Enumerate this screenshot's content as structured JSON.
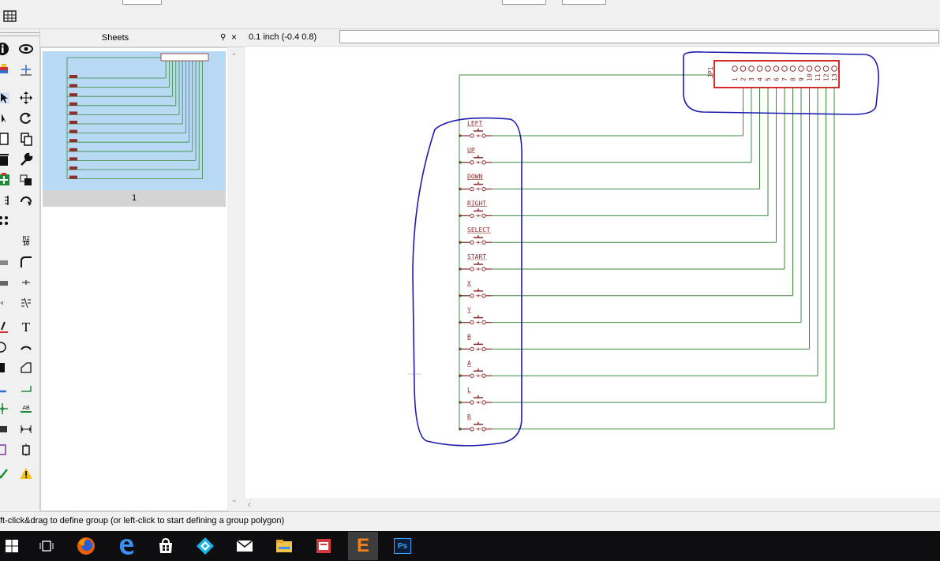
{
  "toolbar": {
    "grid_icon": "grid-icon"
  },
  "left_toolbar": {
    "icons": [
      "info-icon",
      "eye-icon",
      "layer-icon",
      "mark-icon",
      "select-icon",
      "move-icon",
      "copy-pointer-icon",
      "rotate-icon",
      "copy-icon",
      "paste-icon",
      "delete-icon",
      "wrench-icon",
      "add-icon",
      "replace-icon",
      "name-icon",
      "mirror-icon",
      "smash-icon",
      "value-icon",
      "miter-icon",
      "split-icon",
      "junction-icon",
      "label-icon",
      "line-icon",
      "text-icon",
      "circle-icon",
      "arc-icon",
      "rect-icon",
      "polygon-icon",
      "bus-icon",
      "net-icon",
      "pin-icon",
      "attribute-icon",
      "dimension-icon",
      "frame-icon",
      "erc-icon",
      "warning-icon"
    ],
    "text_glyphs": {
      "bus_label": "R2",
      "bus_value": "10",
      "label_text": "AB",
      "text_tool": "T"
    }
  },
  "sheets": {
    "title": "Sheets",
    "float_icon": "pin-icon",
    "close_glyph": "×",
    "items": [
      {
        "label": "1"
      }
    ]
  },
  "coord": {
    "readout": "0.1 inch (-0.4 0.8)",
    "command_value": ""
  },
  "schematic": {
    "connector": {
      "name": "JP1",
      "pins": [
        "1",
        "2",
        "3",
        "4",
        "5",
        "6",
        "7",
        "8",
        "9",
        "10",
        "11",
        "12",
        "13"
      ]
    },
    "buttons": [
      "LEFT",
      "UP",
      "DOWN",
      "RIGHT",
      "SELECT",
      "START",
      "X",
      "Y",
      "B",
      "A",
      "L",
      "R"
    ]
  },
  "status": {
    "text": "ft-click&drag to define group (or left-click to start defining a group polygon)"
  },
  "taskbar": {
    "apps": [
      "windows-start-icon",
      "task-view-icon",
      "firefox-icon",
      "edge-icon",
      "store-icon",
      "kodi-icon",
      "mail-icon",
      "file-explorer-icon",
      "news-icon",
      "eagle-icon",
      "photoshop-icon"
    ],
    "eagle_glyph": "E",
    "photoshop_glyph": "Ps"
  },
  "colors": {
    "net": "#3d8a3d",
    "part": "#8e2c2c",
    "connector_outline": "#d42b2b",
    "annotation": "#1c1cb0",
    "thumb_bg": "#b7d9f3"
  }
}
